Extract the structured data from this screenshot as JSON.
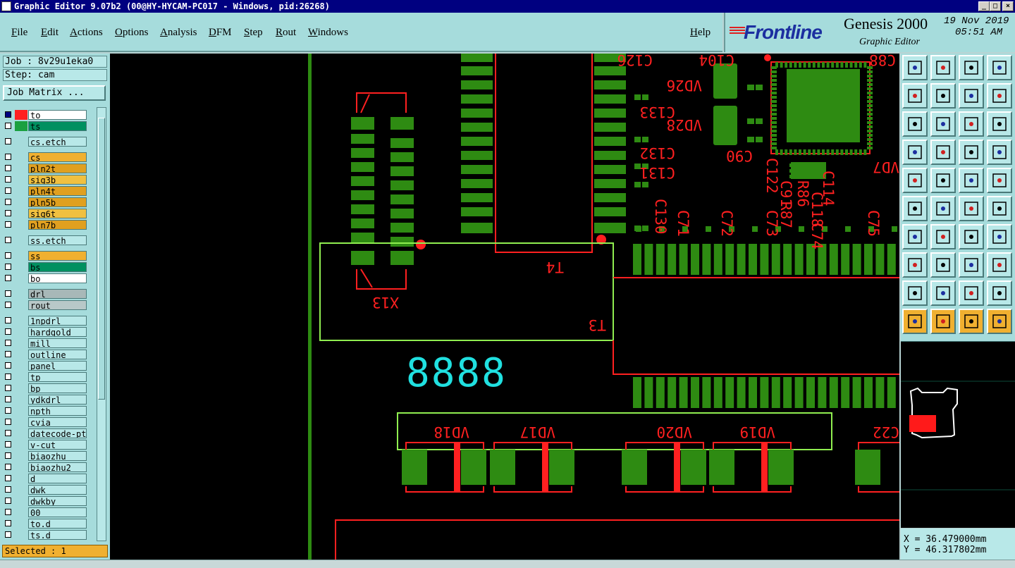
{
  "window": {
    "title": "Graphic Editor 9.07b2 (00@HY-HYCAM-PC017 - Windows, pid:26268)",
    "buttons": [
      "_",
      "□",
      "×"
    ]
  },
  "menu": [
    "File",
    "Edit",
    "Actions",
    "Options",
    "Analysis",
    "DFM",
    "Step",
    "Rout",
    "Windows"
  ],
  "help": "Help",
  "brand": {
    "logo": "Frontline",
    "product": "Genesis 2000",
    "subtitle": "Graphic Editor",
    "date": "19 Nov 2019",
    "time": "05:51 AM"
  },
  "job": {
    "job_label": "Job : 8v29u1eka0",
    "step_label": "Step: cam",
    "matrix_button": "Job Matrix ..."
  },
  "layers": [
    {
      "name": "to",
      "color": "#ffffff",
      "sw": "#ff2020",
      "check": true
    },
    {
      "name": "ts",
      "color": "#009060",
      "sw": "#1aa040",
      "check": false
    },
    {
      "name": "cs.etch",
      "color": "#b8e8e8",
      "sw": "",
      "check": false,
      "gap": true
    },
    {
      "name": "cs",
      "color": "#f0b030",
      "sw": "",
      "check": false,
      "gap": true
    },
    {
      "name": "pln2t",
      "color": "#e0a020",
      "sw": "",
      "check": false
    },
    {
      "name": "sig3b",
      "color": "#f0c040",
      "sw": "",
      "check": false
    },
    {
      "name": "pln4t",
      "color": "#e0a020",
      "sw": "",
      "check": false
    },
    {
      "name": "pln5b",
      "color": "#e0a020",
      "sw": "",
      "check": false
    },
    {
      "name": "sig6t",
      "color": "#f0c040",
      "sw": "",
      "check": false
    },
    {
      "name": "pln7b",
      "color": "#e0a020",
      "sw": "",
      "check": false
    },
    {
      "name": "ss.etch",
      "color": "#b8e8e8",
      "sw": "",
      "check": false,
      "gap": true
    },
    {
      "name": "ss",
      "color": "#f0b030",
      "sw": "",
      "check": false,
      "gap": true
    },
    {
      "name": "bs",
      "color": "#009060",
      "sw": "",
      "check": false
    },
    {
      "name": "bo",
      "color": "#ffffff",
      "sw": "",
      "check": false
    },
    {
      "name": "drl",
      "color": "#a8b8b8",
      "sw": "",
      "check": false,
      "gap": true
    },
    {
      "name": "rout",
      "color": "#b8c8c8",
      "sw": "",
      "check": false
    },
    {
      "name": "1npdrl",
      "color": "#b8e8e8",
      "sw": "",
      "check": false,
      "gap": true
    },
    {
      "name": "hardgold",
      "color": "#b8e8e8",
      "sw": "",
      "check": false
    },
    {
      "name": "mill",
      "color": "#b8e8e8",
      "sw": "",
      "check": false
    },
    {
      "name": "outline",
      "color": "#b8e8e8",
      "sw": "",
      "check": false
    },
    {
      "name": "panel",
      "color": "#b8e8e8",
      "sw": "",
      "check": false
    },
    {
      "name": "tp",
      "color": "#b8e8e8",
      "sw": "",
      "check": false
    },
    {
      "name": "bp",
      "color": "#b8e8e8",
      "sw": "",
      "check": false
    },
    {
      "name": "ydkdrl",
      "color": "#b8e8e8",
      "sw": "",
      "check": false
    },
    {
      "name": "npth",
      "color": "#b8e8e8",
      "sw": "",
      "check": false
    },
    {
      "name": "cvia",
      "color": "#b8e8e8",
      "sw": "",
      "check": false
    },
    {
      "name": "datecode-ptc",
      "color": "#b8e8e8",
      "sw": "",
      "check": false
    },
    {
      "name": "v-cut",
      "color": "#b8e8e8",
      "sw": "",
      "check": false
    },
    {
      "name": "biaozhu",
      "color": "#b8e8e8",
      "sw": "",
      "check": false
    },
    {
      "name": "biaozhu2",
      "color": "#b8e8e8",
      "sw": "",
      "check": false
    },
    {
      "name": "d",
      "color": "#b8e8e8",
      "sw": "",
      "check": false
    },
    {
      "name": "dwk",
      "color": "#b8e8e8",
      "sw": "",
      "check": false
    },
    {
      "name": "dwkby",
      "color": "#b8e8e8",
      "sw": "",
      "check": false
    },
    {
      "name": "00",
      "color": "#b8e8e8",
      "sw": "",
      "check": false
    },
    {
      "name": "to.d",
      "color": "#b8e8e8",
      "sw": "",
      "check": false
    },
    {
      "name": "ts.d",
      "color": "#b8e8e8",
      "sw": "",
      "check": false
    }
  ],
  "status": {
    "selected": "Selected : 1",
    "x": "X  = 36.479000mm",
    "y": "Y  = 46.317802mm"
  },
  "pcb": {
    "ref_labels": [
      "C126",
      "C104",
      "C88",
      "VD26",
      "C133",
      "VD28",
      "C90",
      "C132",
      "C131",
      "C122",
      "C91",
      "R87",
      "R86",
      "C118",
      "C114",
      "VD7",
      "C130",
      "C71",
      "C72",
      "C73",
      "C74",
      "C75",
      "T4",
      "X13",
      "T3",
      "VD18",
      "VD17",
      "VD20",
      "VD19",
      "C22"
    ],
    "counter": "8888"
  },
  "colors": {
    "pad": "#2e8b12",
    "silk": "#ff2020",
    "highlight": "#90ee50",
    "counter": "#20e0e0",
    "panel": "#a6dcdc"
  }
}
